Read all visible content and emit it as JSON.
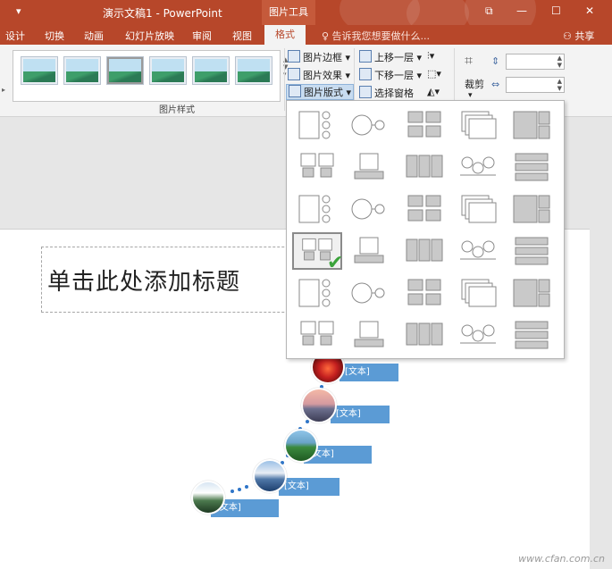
{
  "window": {
    "qat_icon": "dropdown-arrow-icon",
    "title": "演示文稿1 - PowerPoint",
    "context_tab_group": "图片工具",
    "controls": [
      "restore-icon",
      "minimize-icon",
      "maximize-icon",
      "close-icon"
    ]
  },
  "tabs": [
    "设计",
    "切换",
    "动画",
    "幻灯片放映",
    "审阅",
    "视图",
    "格式"
  ],
  "active_tab": "格式",
  "tell_me": "♀ 告诉我您想要做什么...",
  "share": "共享",
  "ribbon": {
    "picture_styles_label": "图片样式",
    "picture_border": "图片边框",
    "picture_effects": "图片效果",
    "picture_layout": "图片版式",
    "bring_forward": "上移一层",
    "send_backward": "下移一层",
    "selection_pane": "选择窗格",
    "crop": "裁剪",
    "dropdown_caret": "▾"
  },
  "slide": {
    "title_placeholder": "单击此处添加标题",
    "items": [
      "[文本]",
      "[文本]",
      "[文本]",
      "[文本]",
      "[文本]"
    ]
  },
  "colors": {
    "title_bar": "#b7472a",
    "smartart_label": "#5b9bd5",
    "dot": "#2e75c8",
    "check": "#3aa33a"
  },
  "watermark": "www.cfan.com.cn"
}
